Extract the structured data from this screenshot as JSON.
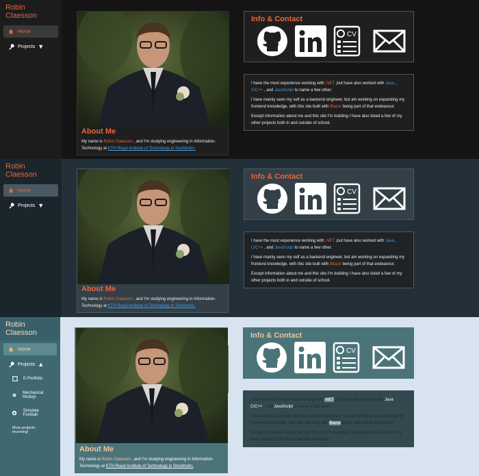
{
  "brand": "Robin Claesson",
  "nav": {
    "home": "Home",
    "projects": "Projects",
    "sub": [
      "E-Portfolio",
      "Mechanical Modoyl",
      "Simulate Football"
    ],
    "more": "More projects incoming!"
  },
  "about": {
    "title": "About Me",
    "p1": "My name is ",
    "name": "Robin Claesson",
    "p2": " , and I'm studying engineering in Information-Technology at ",
    "school": "KTH Royal Institute of Technology in Stockholm."
  },
  "info": {
    "title": "Info & Contact"
  },
  "icons": [
    "github-icon",
    "linkedin-icon",
    "cv-icon",
    "email-icon"
  ],
  "text": {
    "l1a": "I have the most experience working with ",
    "net": ".NET",
    "l1b": " ,but have also worked with ",
    "java": "Java",
    "sep": " , ",
    "cpp": "C/C++",
    "l1c": " , and ",
    "js": "JavaScript",
    "l1d": " to name a few other.",
    "l2a": "I have mainly seen my self as a backend engineer, but am working on expanding my frontend knowledge, with this site built with ",
    "blazor": "Blazor",
    "l2b": " being part of that endeavour.",
    "l3": "Except information about me and this site I'm building I have also listed a few of my other projects both in and outside of school."
  },
  "themes": [
    {
      "bg": "#141414",
      "side": "#222222",
      "card": "#1f1f1f",
      "active": "#3a3a3a",
      "brand": "#e8663d"
    },
    {
      "bg": "#233039",
      "side": "#1b252c",
      "card": "#334048",
      "active": "#4a5961",
      "brand": "#e8663d"
    },
    {
      "bg": "#d7e4ef",
      "side": "#3f6870",
      "card": "#4b7479",
      "active": "#5d8a90",
      "brand": "#f3d9c0"
    }
  ]
}
